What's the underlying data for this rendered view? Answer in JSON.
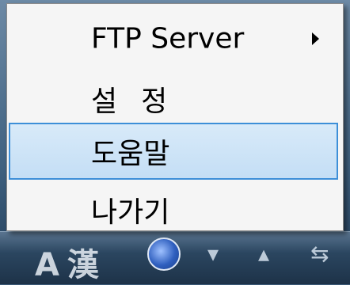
{
  "taskbar": {
    "language_indicator": "A 漢",
    "tray_icons": [
      "globe-icon",
      "arrow-down-icon",
      "up-arrow-icon",
      "network-icon"
    ],
    "arrow_down_glyph": "▾",
    "arrow_up_glyph": "▴",
    "network_glyph": "⇆"
  },
  "context_menu": {
    "items": [
      {
        "label": "FTP Server",
        "has_submenu": true,
        "highlighted": false
      },
      {
        "label": "설정",
        "has_submenu": false,
        "highlighted": false
      },
      {
        "label": "도움말",
        "has_submenu": false,
        "highlighted": true
      },
      {
        "label": "나가기",
        "has_submenu": false,
        "highlighted": false
      }
    ],
    "highlight_color": "#c4def5",
    "highlight_border_color": "#3d8fd8"
  }
}
